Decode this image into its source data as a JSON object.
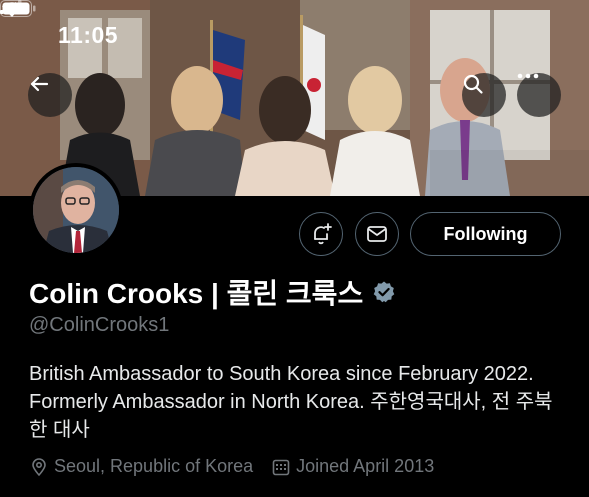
{
  "status_bar": {
    "time": "11:05"
  },
  "header": {
    "back_icon": "arrow-left-icon",
    "search_icon": "search-icon",
    "more_icon": "more-horizontal-icon"
  },
  "profile": {
    "display_name": "Colin Crooks | 콜린 크룩스",
    "handle": "@ColinCrooks1",
    "bio": "British Ambassador to South Korea since February 2022. Formerly Ambassador in North Korea. 주한영국대사, 전 주북한 대사",
    "location": "Seoul, Republic of Korea",
    "joined": "Joined April 2013"
  },
  "actions": {
    "notify_icon": "bell-plus-icon",
    "message_icon": "envelope-icon",
    "follow_label": "Following"
  },
  "colors": {
    "background": "#000000",
    "text_primary": "#e7e9ea",
    "text_secondary": "#71767b",
    "border": "#536471"
  }
}
